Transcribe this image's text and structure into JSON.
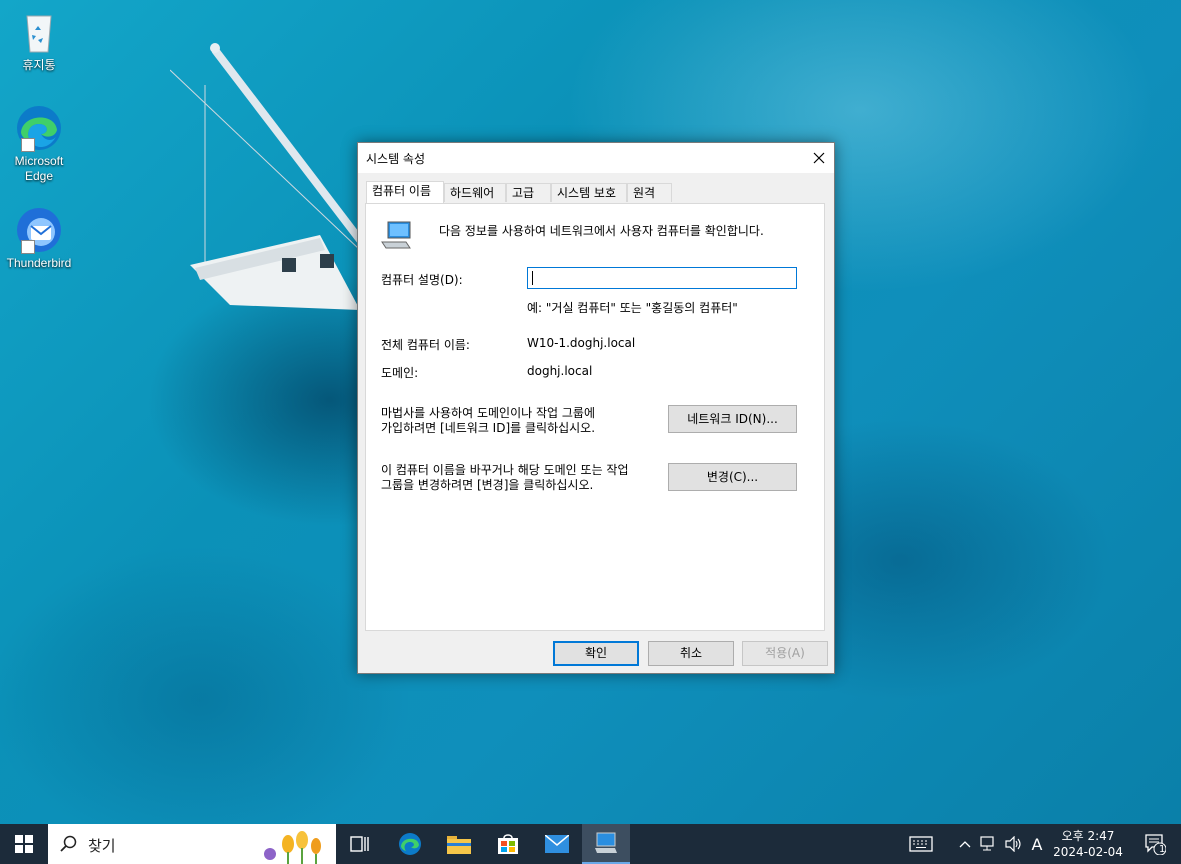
{
  "desktop": {
    "icons": [
      {
        "label": "휴지통",
        "name": "recycle-bin"
      },
      {
        "label": "Microsoft Edge",
        "name": "microsoft-edge"
      },
      {
        "label": "Thunderbird",
        "name": "thunderbird"
      }
    ]
  },
  "dialog": {
    "title": "시스템 속성",
    "tabs": [
      "컴퓨터 이름",
      "하드웨어",
      "고급",
      "시스템 보호",
      "원격"
    ],
    "active_tab": "컴퓨터 이름",
    "intro": "다음 정보를 사용하여 네트워크에서 사용자 컴퓨터를 확인합니다.",
    "description_label": "컴퓨터 설명(D):",
    "description_value": "",
    "description_example": "예: \"거실 컴퓨터\" 또는 \"홍길동의 컴퓨터\"",
    "full_name_label": "전체 컴퓨터 이름:",
    "full_name_value": "W10-1.doghj.local",
    "domain_label": "도메인:",
    "domain_value": "doghj.local",
    "network_id_text_line1": "마법사를 사용하여 도메인이나 작업 그룹에",
    "network_id_text_line2": "가입하려면 [네트워크 ID]를 클릭하십시오.",
    "network_id_button": "네트워크 ID(N)...",
    "change_text_line1": "이 컴퓨터 이름을 바꾸거나 해당 도메인 또는 작업",
    "change_text_line2": "그룹을 변경하려면 [변경]을 클릭하십시오.",
    "change_button": "변경(C)...",
    "ok_button": "확인",
    "cancel_button": "취소",
    "apply_button": "적용(A)"
  },
  "taskbar": {
    "search_placeholder": "찾기",
    "ime_indicator": "A",
    "time": "오후 2:47",
    "date": "2024-02-04",
    "notification_count": "1"
  },
  "colors": {
    "accent": "#0078d7",
    "taskbar_bg": "#1c2b3a",
    "desktop_water": "#0b91b8"
  }
}
